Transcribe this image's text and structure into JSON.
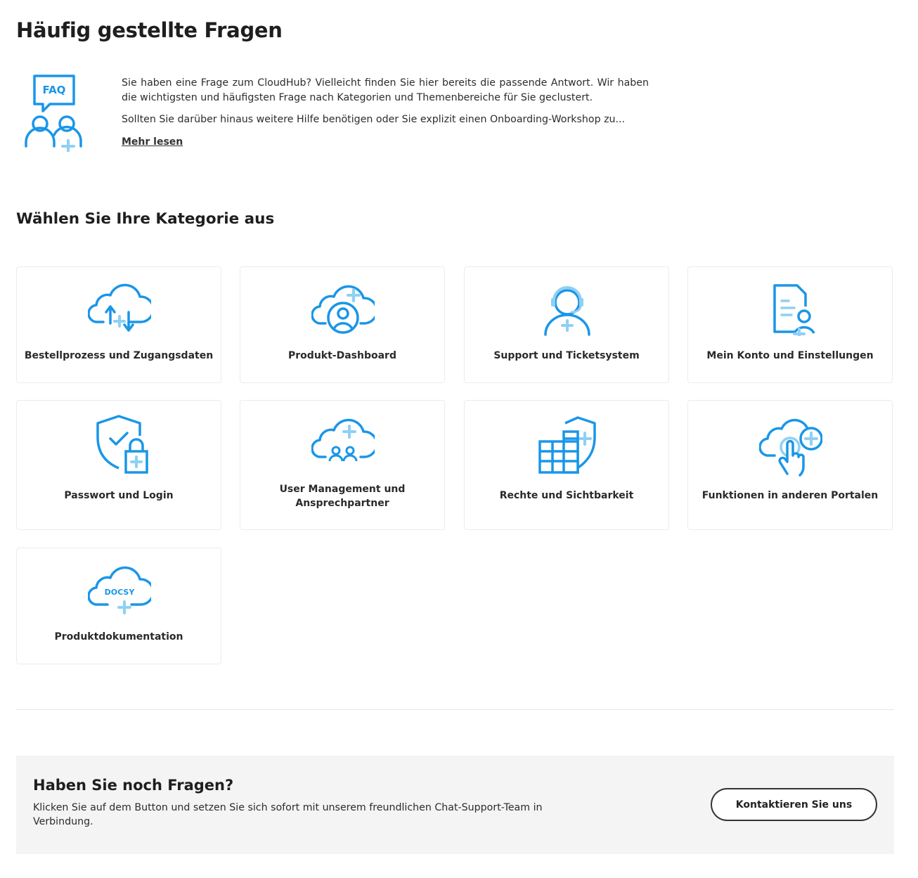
{
  "page": {
    "title": "Häufig gestellte Fragen"
  },
  "intro": {
    "icon": "faq-people-icon",
    "faq_badge": "FAQ",
    "paragraph1": "Sie haben eine Frage zum CloudHub? Vielleicht finden Sie hier bereits die passende Antwort. Wir haben die wichtigsten und häufigsten Frage nach Kategorien und Themenbereiche für Sie geclustert.",
    "paragraph2": "Sollten Sie darüber hinaus weitere Hilfe benötigen oder Sie explizit einen Onboarding-Workshop zu...",
    "read_more": "Mehr lesen"
  },
  "categories": {
    "title": "Wählen Sie Ihre Kategorie aus",
    "items": [
      {
        "label": "Bestellprozess und Zugangsdaten",
        "icon": "cloud-sync-icon"
      },
      {
        "label": "Produkt-Dashboard",
        "icon": "cloud-user-icon"
      },
      {
        "label": "Support und Ticketsystem",
        "icon": "headset-agent-icon"
      },
      {
        "label": "Mein Konto und Einstellungen",
        "icon": "document-user-icon"
      },
      {
        "label": "Passwort und Login",
        "icon": "shield-lock-icon"
      },
      {
        "label": "User Management und Ansprechpartner",
        "icon": "cloud-users-icon"
      },
      {
        "label": "Rechte und Sichtbarkeit",
        "icon": "building-shield-icon"
      },
      {
        "label": "Funktionen in anderen Portalen",
        "icon": "cloud-touch-icon"
      },
      {
        "label": "Produktdokumentation",
        "icon": "cloud-docsy-icon",
        "badge": "DOCSY"
      }
    ]
  },
  "contact": {
    "title": "Haben Sie noch Fragen?",
    "text": "Klicken Sie auf dem Button und setzen Sie sich sofort mit unserem freundlichen Chat-Support-Team in Verbindung.",
    "button": "Kontaktieren Sie uns"
  },
  "colors": {
    "icon_primary": "#1a96e8",
    "icon_accent": "#8fd0f4",
    "contact_bg": "#f4f4f4"
  }
}
